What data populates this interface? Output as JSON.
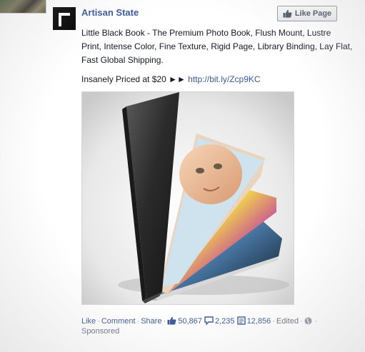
{
  "page": {
    "name": "Artisan State",
    "like_button_label": "Like Page"
  },
  "post": {
    "description": "Little Black Book - The Premium Photo Book, Flush Mount, Lustre Print, Intense Color, Fine Texture, Rigid Page, Library Binding, Lay Flat, Fast Global Shipping.",
    "promo_text": "Insanely Priced at $20 ►► ",
    "promo_link": "http://bit.ly/Zcp9KC",
    "image_icon": "photo-book-image"
  },
  "footer": {
    "like_label": "Like",
    "comment_label": "Comment",
    "share_label": "Share",
    "likes_count": "50,867",
    "comments_count": "2,235",
    "shares_count": "12,856",
    "edited_label": "Edited",
    "sponsored_label": "Sponsored"
  },
  "colors": {
    "link": "#3b5998",
    "meta": "#6a7180"
  }
}
